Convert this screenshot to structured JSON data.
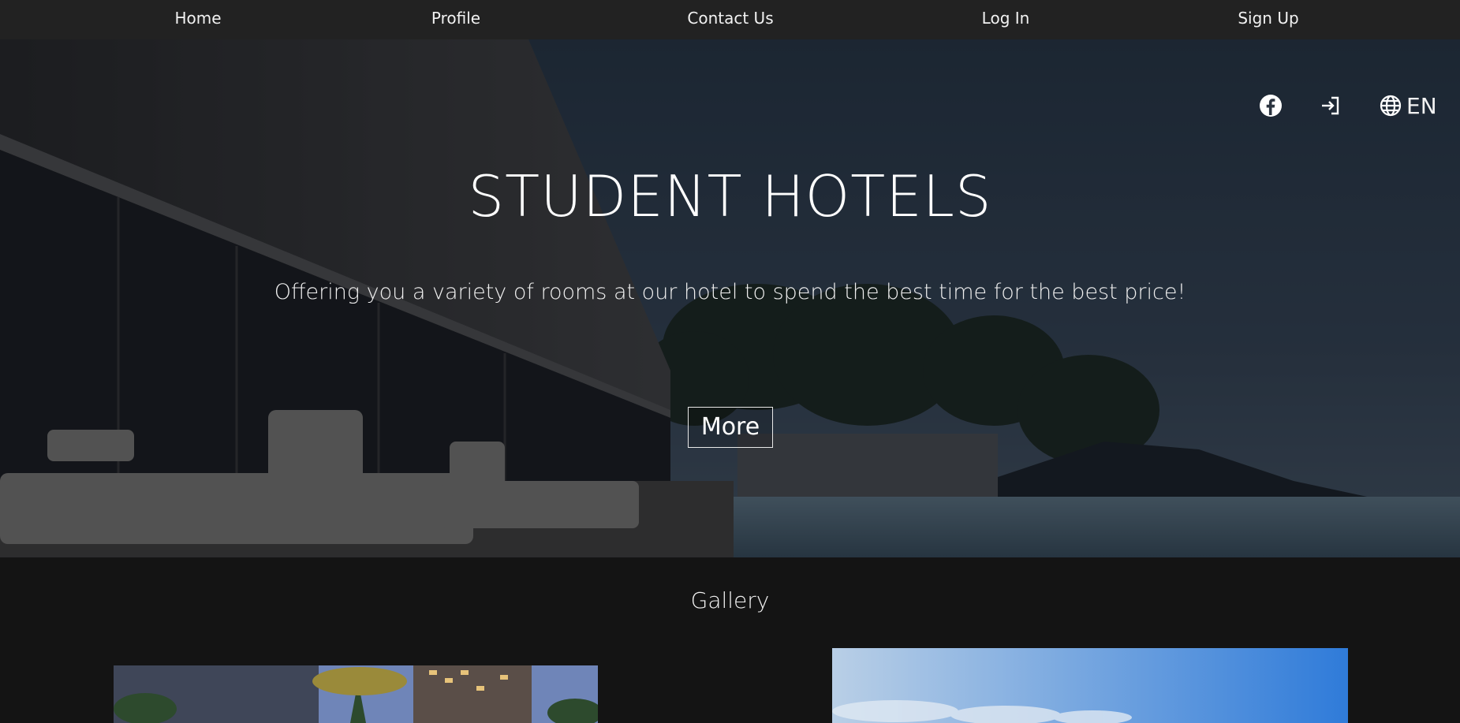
{
  "nav": {
    "items": [
      {
        "label": "Home"
      },
      {
        "label": "Profile"
      },
      {
        "label": "Contact Us"
      },
      {
        "label": "Log In"
      },
      {
        "label": "Sign Up"
      }
    ]
  },
  "hero": {
    "title": "STUDENT HOTELS",
    "subtitle": "Offering you a variety of rooms at our hotel to spend the best time for the best price!",
    "more_label": "More",
    "lang_label": "EN",
    "icons": [
      "facebook-icon",
      "login-icon",
      "globe-icon"
    ]
  },
  "gallery": {
    "title": "Gallery"
  },
  "colors": {
    "nav_bg": "#222222",
    "page_bg": "#141414",
    "text": "#ffffff"
  }
}
